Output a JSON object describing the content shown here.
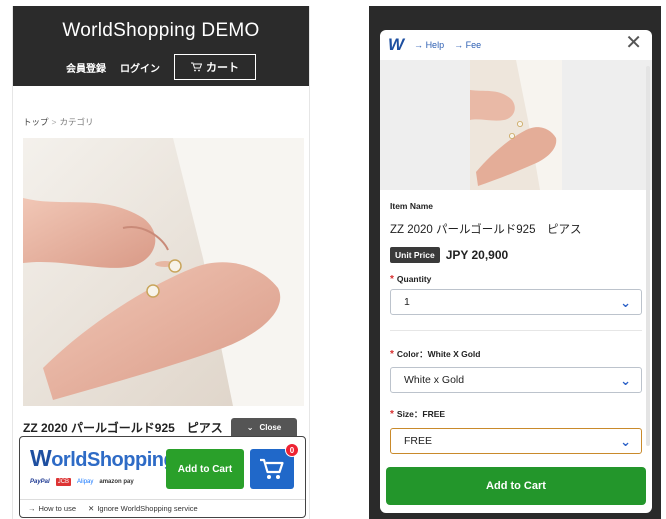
{
  "left": {
    "site_title": "WorldShopping DEMO",
    "nav": {
      "register": "会員登録",
      "login": "ログイン",
      "cart": "カート"
    },
    "breadcrumb": {
      "top": "トップ",
      "sep": ">",
      "category": "カテゴリ"
    },
    "product_title": "ZZ 2020 パールゴールド925　ピアス",
    "close_label": "Close",
    "widget": {
      "logo_w": "W",
      "logo_rest": "orldShopping",
      "payments": [
        "PayPal",
        "JCB",
        "Alipay",
        "amazon pay"
      ],
      "add_to_cart": "Add to Cart",
      "cart_count": "0",
      "how_to_use": "How to use",
      "ignore": "Ignore WorldShopping service"
    }
  },
  "modal": {
    "logo": "W",
    "help": "Help",
    "fee": "Fee",
    "item_name_label": "Item Name",
    "item_name": "ZZ 2020 パールゴールド925　ピアス",
    "unit_price_label": "Unit Price",
    "unit_price": "JPY 20,900",
    "quantity_label": "Quantity",
    "quantity_value": "1",
    "color_label": "Color：White X Gold",
    "color_value": "White x Gold",
    "size_label": "Size：FREE",
    "size_value": "FREE",
    "add_to_cart": "Add to Cart"
  },
  "colors": {
    "primary_blue": "#2068c9",
    "cta_green": "#2aa02a",
    "required_red": "#d62f2f",
    "header_dark": "#2b2b2b"
  }
}
